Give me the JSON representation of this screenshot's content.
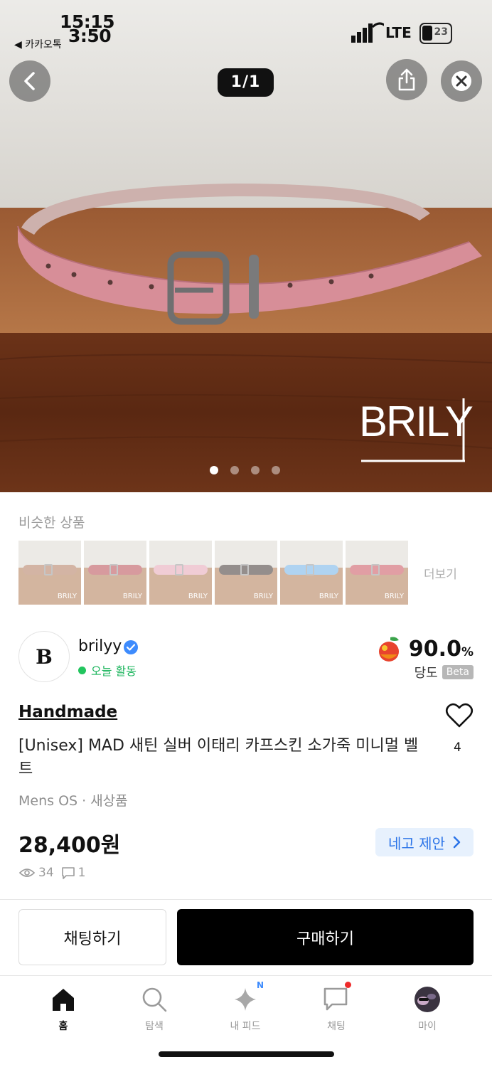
{
  "status_bar": {
    "time_primary": "15:15",
    "time_secondary": "3:50",
    "back_app": "◀ 카카오톡",
    "network": "LTE",
    "battery": "23"
  },
  "viewer": {
    "counter": "1/1",
    "watermark": "BRILY",
    "dots_total": 4,
    "dots_active": 0
  },
  "similar": {
    "title": "비슷한 상품",
    "more": "더보기",
    "items": [
      {
        "label": "BRILY",
        "color": "#b0785a"
      },
      {
        "label": "BRILY",
        "color": "#b8484f"
      },
      {
        "label": "BRILY",
        "color": "#e4a3b3"
      },
      {
        "label": "BRILY",
        "color": "#3e3330"
      },
      {
        "label": "BRILY",
        "color": "#6fb0e6"
      },
      {
        "label": "BRILY",
        "color": "#c9505a"
      }
    ]
  },
  "seller": {
    "avatar_letter": "B",
    "name": "brilyy",
    "activity": "오늘 활동",
    "score_value": "90.0",
    "score_unit": "%",
    "score_label": "당도",
    "score_badge": "Beta"
  },
  "product": {
    "brand": "Handmade",
    "title": "[Unisex] MAD 새틴 실버 이태리 카프스킨 소가죽 미니멀 벨트",
    "likes": "4",
    "meta": "Mens OS · 새상품",
    "price": "28,400원",
    "offer_label": "네고 제안",
    "views": "34",
    "comments": "1"
  },
  "actions": {
    "chat": "채팅하기",
    "buy": "구매하기"
  },
  "tabs": [
    {
      "label": "홈",
      "icon": "home-icon",
      "active": true
    },
    {
      "label": "탐색",
      "icon": "search-icon",
      "active": false
    },
    {
      "label": "내 피드",
      "icon": "sparkle-icon",
      "active": false,
      "badge": "N"
    },
    {
      "label": "채팅",
      "icon": "chat-icon",
      "active": false,
      "dot": true
    },
    {
      "label": "마이",
      "icon": "profile-avatar-icon",
      "active": false
    }
  ],
  "colors": {
    "accent_blue": "#2a73e8",
    "active_green": "#22c55e",
    "belt_pink": "#d78e98",
    "wood": "#7a3f1e"
  }
}
